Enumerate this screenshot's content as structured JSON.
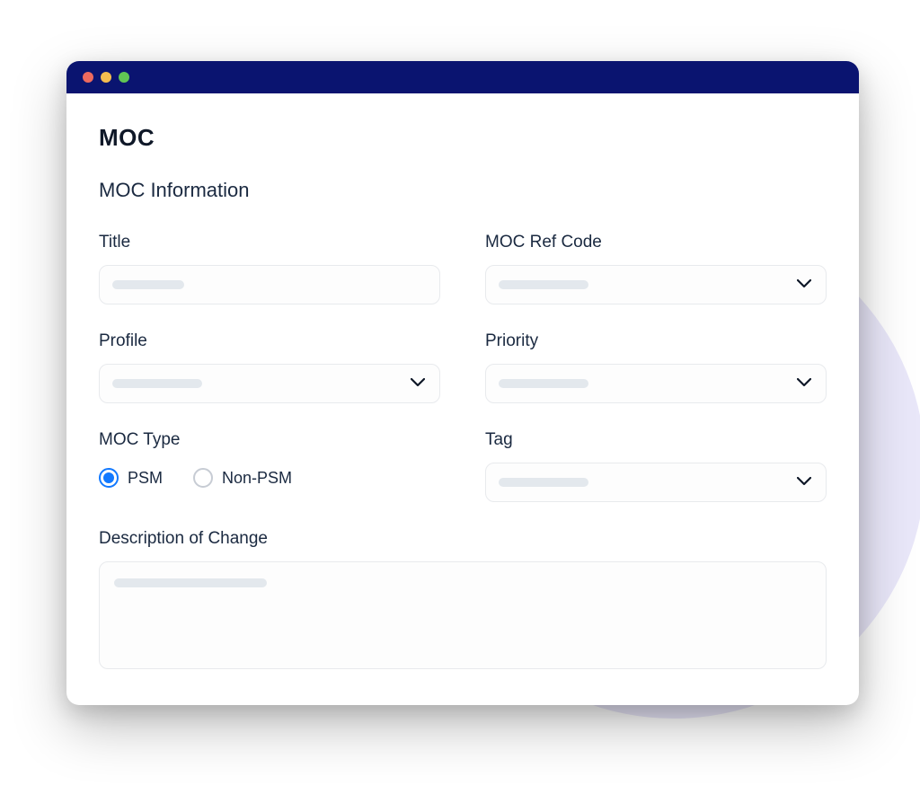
{
  "page": {
    "title": "MOC",
    "section_title": "MOC Information"
  },
  "fields": {
    "title_label": "Title",
    "ref_code_label": "MOC Ref Code",
    "profile_label": "Profile",
    "priority_label": "Priority",
    "moc_type_label": "MOC Type",
    "tag_label": "Tag",
    "description_label": "Description of Change"
  },
  "moc_type": {
    "option_psm": "PSM",
    "option_non_psm": "Non-PSM",
    "selected": "PSM"
  },
  "colors": {
    "titlebar": "#0a1470",
    "accent": "#1279ff",
    "bg_circle": "#e9e7f9"
  }
}
